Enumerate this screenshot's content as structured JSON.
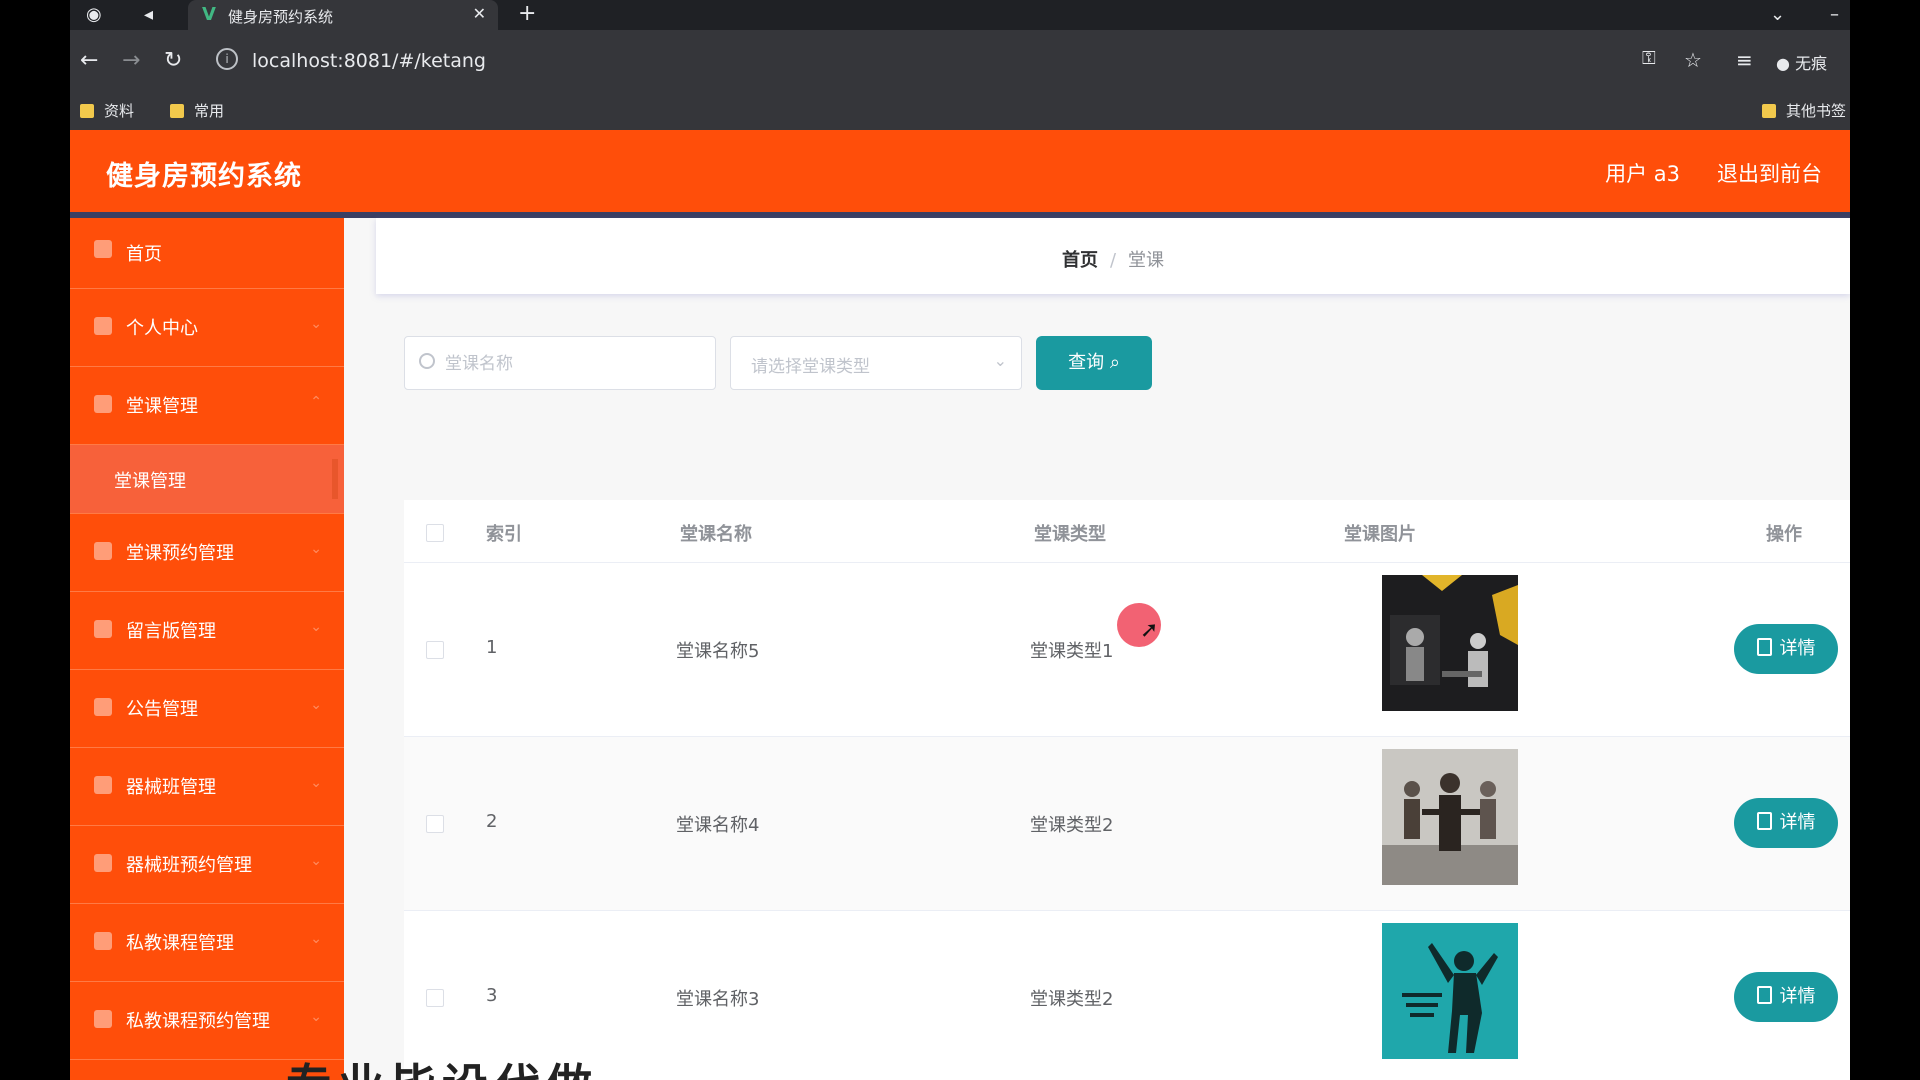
{
  "browser": {
    "tab_title": "健身房预约系统",
    "tab_logo": "V",
    "url": "localhost:8081/#/ketang",
    "profile_label": "无痕",
    "bookmarks": [
      "资料",
      "常用"
    ],
    "other_bookmarks": "其他书签"
  },
  "header": {
    "title": "健身房预约系统",
    "user": "用户 a3",
    "exit": "退出到前台"
  },
  "sidebar": {
    "items": [
      {
        "label": "首页",
        "icon": "home-icon"
      },
      {
        "label": "个人中心",
        "icon": "user-icon"
      },
      {
        "label": "堂课管理",
        "icon": "class-icon"
      },
      {
        "label": "堂课管理",
        "icon": ""
      },
      {
        "label": "堂课预约管理",
        "icon": "calendar-icon"
      },
      {
        "label": "留言版管理",
        "icon": "clock-icon"
      },
      {
        "label": "公告管理",
        "icon": "send-icon"
      },
      {
        "label": "器械班管理",
        "icon": "equipment-icon"
      },
      {
        "label": "器械班预约管理",
        "icon": "user-icon"
      },
      {
        "label": "私教课程管理",
        "icon": "coach-icon"
      },
      {
        "label": "私教课程预约管理",
        "icon": "clock-icon"
      }
    ]
  },
  "breadcrumb": {
    "home": "首页",
    "separator": "/",
    "current": "堂课"
  },
  "search": {
    "name_placeholder": "堂课名称",
    "type_placeholder": "请选择堂课类型",
    "query_label": "查询"
  },
  "table": {
    "headers": [
      "索引",
      "堂课名称",
      "堂课类型",
      "堂课图片",
      "操作"
    ],
    "rows": [
      {
        "index": "1",
        "name": "堂课名称5",
        "type": "堂课类型1",
        "action": "详情"
      },
      {
        "index": "2",
        "name": "堂课名称4",
        "type": "堂课类型2",
        "action": "详情"
      },
      {
        "index": "3",
        "name": "堂课名称3",
        "type": "堂课类型2",
        "action": "详情"
      }
    ]
  },
  "overlay_caption": "专业毕设代做",
  "colors": {
    "header": "#ff4e0a",
    "accent": "#1a9aa0",
    "header_border": "#3a3f63"
  }
}
